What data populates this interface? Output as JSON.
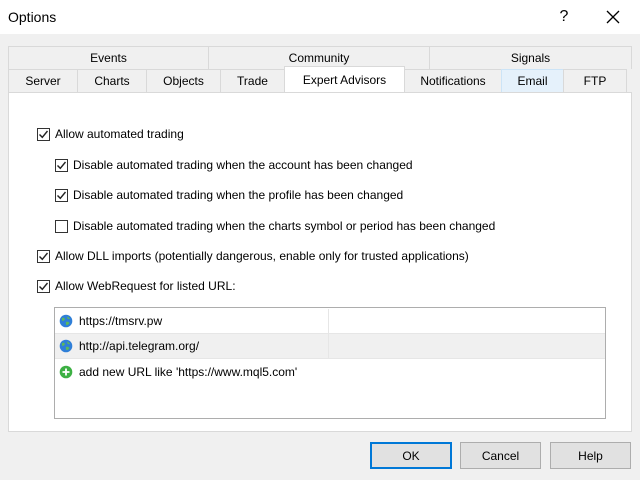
{
  "window": {
    "title": "Options",
    "help_glyph": "?"
  },
  "tabs": {
    "upper": [
      {
        "label": "Events",
        "width": 201
      },
      {
        "label": "Community",
        "width": 221
      },
      {
        "label": "Signals",
        "width": 203
      }
    ],
    "lower": [
      {
        "label": "Server"
      },
      {
        "label": "Charts"
      },
      {
        "label": "Objects"
      },
      {
        "label": "Trade"
      },
      {
        "label": "Expert Advisors"
      },
      {
        "label": "Notifications"
      },
      {
        "label": "Email"
      },
      {
        "label": "FTP"
      }
    ]
  },
  "options": {
    "allow_auto": {
      "label": "Allow automated trading",
      "checked": true
    },
    "disable_account": {
      "label": "Disable automated trading when the account has been changed",
      "checked": true
    },
    "disable_profile": {
      "label": "Disable automated trading when the profile has been changed",
      "checked": true
    },
    "disable_symbol": {
      "label": "Disable automated trading when the charts symbol or period has been changed",
      "checked": false
    },
    "allow_dll": {
      "label": "Allow DLL imports (potentially dangerous, enable only for trusted applications)",
      "checked": true
    },
    "allow_webrequest": {
      "label": "Allow WebRequest for listed URL:",
      "checked": true
    }
  },
  "url_list": {
    "items": [
      "https://tmsrv.pw",
      "http://api.telegram.org/"
    ],
    "add_prompt": "add new URL like 'https://www.mql5.com'"
  },
  "buttons": {
    "ok": "OK",
    "cancel": "Cancel",
    "help": "Help"
  },
  "icons": [
    "close-icon",
    "check-icon",
    "globe-icon",
    "plus-icon"
  ],
  "colors": {
    "accent": "#0078d7",
    "add_green": "#3cb043"
  }
}
